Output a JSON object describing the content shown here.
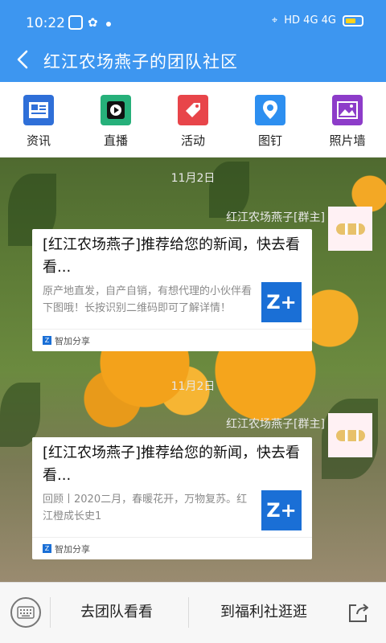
{
  "status_bar": {
    "time": "10:22",
    "indicators": "HD 4G 4G"
  },
  "header": {
    "title": "红江农场燕子的团队社区"
  },
  "tabs": [
    {
      "label": "资讯",
      "icon": "news-icon",
      "color": "#2f6fd8"
    },
    {
      "label": "直播",
      "icon": "live-icon",
      "color": "#26b07a"
    },
    {
      "label": "活动",
      "icon": "tag-icon",
      "color": "#e8454a"
    },
    {
      "label": "图钉",
      "icon": "pin-icon",
      "color": "#2d8ff0"
    },
    {
      "label": "照片墙",
      "icon": "photo-icon",
      "color": "#8d3cc9"
    }
  ],
  "messages": [
    {
      "date": "11月2日",
      "sender": "红江农场燕子[群主]",
      "title": "[红江农场燕子]推荐给您的新闻，快去看看...",
      "desc": "原产地直发，自产自销，有想代理的小伙伴看下图哦！长按识别二维码即可了解详情！",
      "logo": "Z+",
      "footer": "智加分享"
    },
    {
      "date": "11月2日",
      "sender": "红江农场燕子[群主]",
      "title": "[红江农场燕子]推荐给您的新闻，快去看看...",
      "desc": "回顾丨2020二月，春暖花开，万物复苏。红江橙成长史1",
      "logo": "Z+",
      "footer": "智加分享"
    }
  ],
  "bottom_bar": {
    "btn1": "去团队看看",
    "btn2": "到福利社逛逛"
  }
}
